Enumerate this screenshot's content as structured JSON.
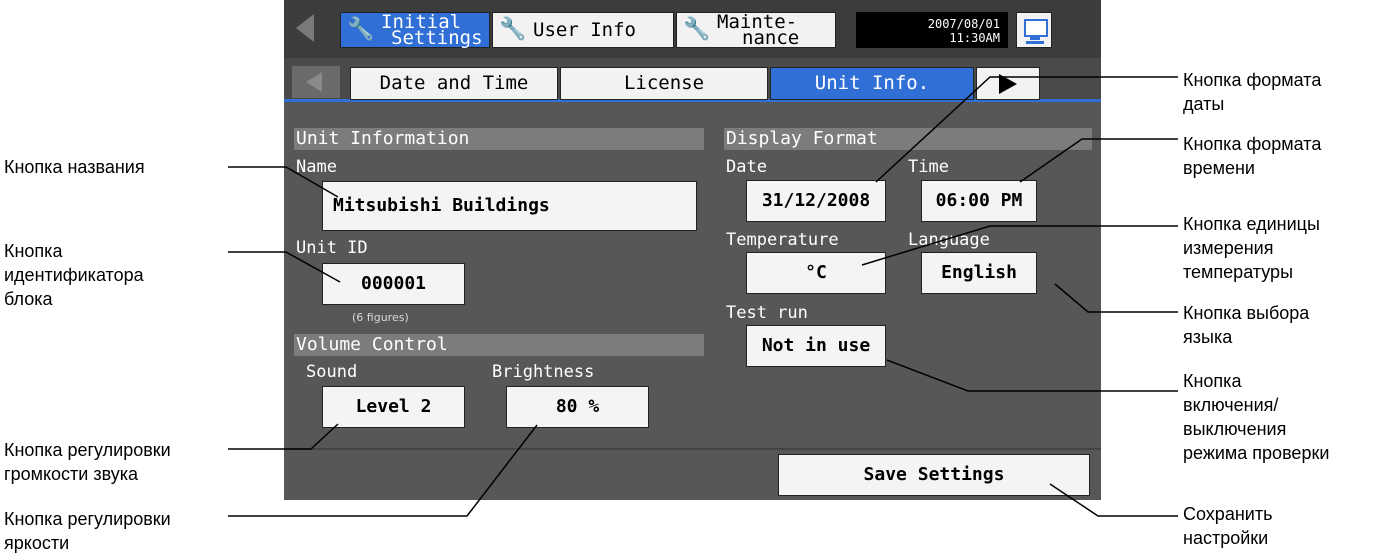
{
  "header": {
    "tabs": [
      {
        "line1": "Initial",
        "line2": "Settings"
      },
      {
        "line1": "User Info",
        "line2": ""
      },
      {
        "line1": "Mainte-",
        "line2": "nance"
      }
    ],
    "date": "2007/08/01",
    "time": "11:30AM"
  },
  "subtabs": [
    "Date and Time",
    "License",
    "Unit Info."
  ],
  "unit_info": {
    "section_title": "Unit Information",
    "name_label": "Name",
    "name_value": "Mitsubishi Buildings",
    "id_label": "Unit ID",
    "id_value": "000001",
    "id_note": "(6 figures)"
  },
  "volume": {
    "section_title": "Volume Control",
    "sound_label": "Sound",
    "sound_value": "Level 2",
    "brightness_label": "Brightness",
    "brightness_value": "80 %"
  },
  "display_format": {
    "section_title": "Display Format",
    "date_label": "Date",
    "date_value": "31/12/2008",
    "time_label": "Time",
    "time_value": "06:00 PM",
    "temp_label": "Temperature",
    "temp_value": "°C",
    "lang_label": "Language",
    "lang_value": "English",
    "test_label": "Test run",
    "test_value": "Not in use"
  },
  "save_label": "Save Settings",
  "callouts": {
    "name_button": "Кнопка названия",
    "unit_id_button": "Кнопка\nидентификатора\nблока",
    "sound_button": "Кнопка регулировки\nгромкости звука",
    "brightness_button": "Кнопка регулировки\nяркости",
    "date_format_button": "Кнопка формата\nдаты",
    "time_format_button": "Кнопка формата\nвремени",
    "temp_unit_button": "Кнопка единицы\nизмерения\nтемпературы",
    "language_button": "Кнопка выбора\nязыка",
    "test_run_button": "Кнопка\nвключения/\nвыключения\nрежима проверки",
    "save_button": "Сохранить\nнастройки"
  },
  "colors": {
    "accent": "#2f6fd6",
    "panel": "#575757"
  }
}
